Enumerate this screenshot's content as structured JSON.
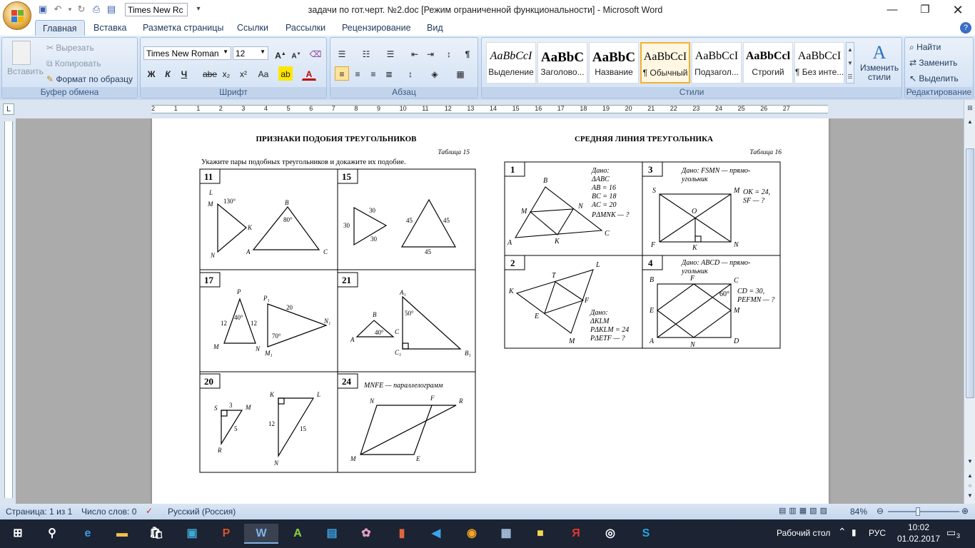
{
  "title": {
    "document": "задачи по гот.черт. №2.doc [Режим ограниченной функциональности] - Microsoft Word"
  },
  "qat": {
    "font_box": "Times New Rc"
  },
  "tabs": [
    "Главная",
    "Вставка",
    "Разметка страницы",
    "Ссылки",
    "Рассылки",
    "Рецензирование",
    "Вид"
  ],
  "clipboard": {
    "paste": "Вставить",
    "cut": "Вырезать",
    "copy": "Копировать",
    "format_painter": "Формат по образцу",
    "label": "Буфер обмена"
  },
  "font": {
    "name": "Times New Roman",
    "size": "12",
    "label": "Шрифт",
    "bold": "Ж",
    "italic": "К",
    "underline": "Ч",
    "strike": "abe",
    "sub": "x₂",
    "sup": "x²",
    "case": "Aa"
  },
  "paragraph": {
    "label": "Абзац"
  },
  "styles": {
    "label": "Стили",
    "items": [
      {
        "sample": "AaBbCcI",
        "name": "Выделение"
      },
      {
        "sample": "AaBbC",
        "name": "Заголово..."
      },
      {
        "sample": "AaBbC",
        "name": "Название"
      },
      {
        "sample": "AaBbCcI",
        "name": "¶ Обычный"
      },
      {
        "sample": "AaBbCcI",
        "name": "Подзагол..."
      },
      {
        "sample": "AaBbCcl",
        "name": "Строгий"
      },
      {
        "sample": "AaBbCcI",
        "name": "¶ Без инте..."
      }
    ],
    "change": "Изменить стили"
  },
  "editing": {
    "find": "Найти",
    "replace": "Заменить",
    "select": "Выделить",
    "label": "Редактирование"
  },
  "ruler": {
    "h": [
      "2",
      "1",
      "1",
      "2",
      "3",
      "4",
      "5",
      "6",
      "7",
      "8",
      "9",
      "10",
      "11",
      "12",
      "13",
      "14",
      "15",
      "16",
      "17",
      "18",
      "19",
      "20",
      "21",
      "22",
      "23",
      "24",
      "25",
      "26",
      "27"
    ]
  },
  "page": {
    "left_title": "ПРИЗНАКИ ПОДОБИЯ ТРЕУГОЛЬНИКОВ",
    "left_table": "Таблица 15",
    "left_task": "Укажите пары подобных треугольников и докажите их подобие.",
    "cells": [
      "11",
      "15",
      "17",
      "21",
      "20",
      "24"
    ],
    "cell24_text": "MNFE — параллелограмм",
    "right_title": "СРЕДНЯЯ ЛИНИЯ ТРЕУГОЛЬНИКА",
    "right_table": "Таблица 16",
    "rcells": [
      "1",
      "3",
      "2",
      "4"
    ],
    "r1_given": [
      "Дано:",
      "ΔABC",
      "AB = 16",
      "BC = 18",
      "AC = 20",
      "PΔMNK — ?"
    ],
    "r3_given": [
      "Дано: FSMN — прямо-",
      "угольник",
      "OK = 24,",
      "SF — ?"
    ],
    "r2_given": [
      "Дано:",
      "ΔKLM",
      "PΔKLM = 24",
      "PΔETF — ?"
    ],
    "r4_given": [
      "Дано: ABCD — прямо-",
      "угольник",
      "CD = 30,",
      "PEFMN — ?"
    ]
  },
  "status": {
    "page": "Страница: 1 из 1",
    "words": "Число слов: 0",
    "lang": "Русский (Россия)",
    "zoom": "84%"
  },
  "taskbar": {
    "desktop": "Рабочий стол",
    "lang": "РУС",
    "time": "10:02",
    "date": "01.02.2017",
    "notif": "3"
  }
}
